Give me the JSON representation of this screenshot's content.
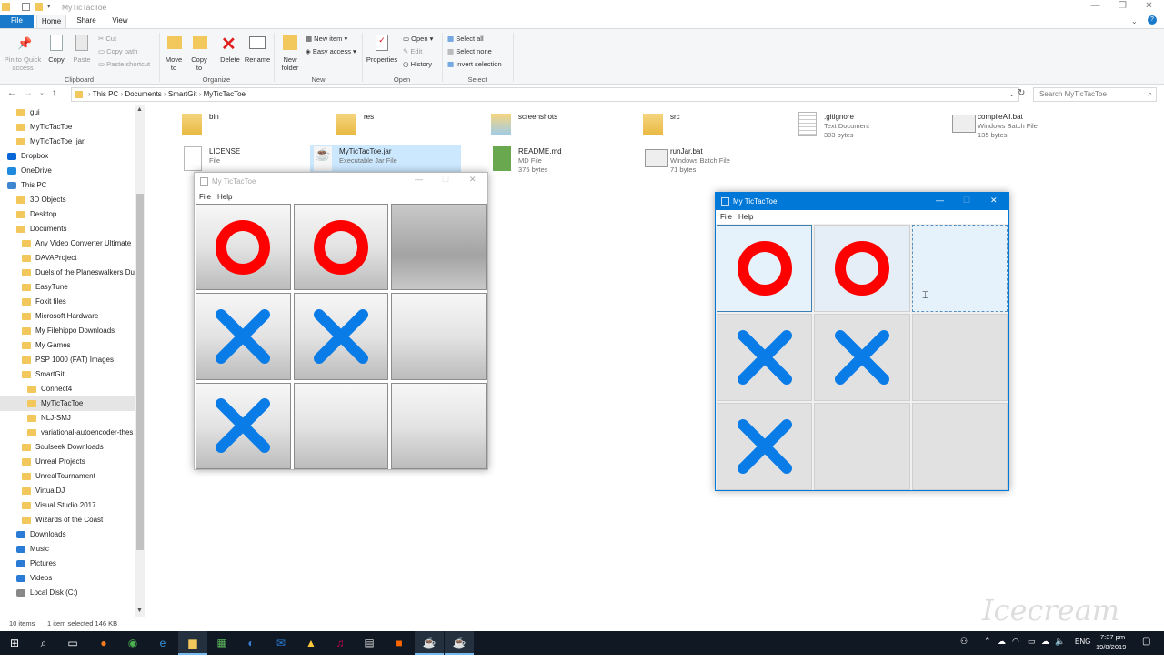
{
  "window": {
    "title": "MyTicTacToe"
  },
  "ribbon": {
    "tabs": [
      "File",
      "Home",
      "Share",
      "View"
    ],
    "clipboard": {
      "pin": "Pin to Quick\naccess",
      "copy": "Copy",
      "paste": "Paste",
      "cut": "Cut",
      "copy_path": "Copy path",
      "paste_shortcut": "Paste shortcut",
      "label": "Clipboard"
    },
    "organize": {
      "move": "Move\nto",
      "copy": "Copy\nto",
      "delete": "Delete",
      "rename": "Rename",
      "label": "Organize"
    },
    "new": {
      "folder": "New\nfolder",
      "new_item": "New item",
      "easy_access": "Easy access",
      "label": "New"
    },
    "open": {
      "properties": "Properties",
      "open": "Open",
      "edit": "Edit",
      "history": "History",
      "label": "Open"
    },
    "select": {
      "all": "Select all",
      "none": "Select none",
      "invert": "Invert selection",
      "label": "Select"
    }
  },
  "address": {
    "path": [
      "This PC",
      "Documents",
      "SmartGit",
      "MyTicTacToe"
    ],
    "search_placeholder": "Search MyTicTacToe"
  },
  "nav": {
    "items": [
      {
        "label": "gui",
        "indent": 2,
        "icon": "folder"
      },
      {
        "label": "MyTicTacToe",
        "indent": 2,
        "icon": "folder"
      },
      {
        "label": "MyTicTacToe_jar",
        "indent": 2,
        "icon": "folder"
      },
      {
        "label": "Dropbox",
        "indent": 1,
        "icon": "dropbox"
      },
      {
        "label": "OneDrive",
        "indent": 1,
        "icon": "cloud"
      },
      {
        "label": "This PC",
        "indent": 1,
        "icon": "pc"
      },
      {
        "label": "3D Objects",
        "indent": 2,
        "icon": "folder"
      },
      {
        "label": "Desktop",
        "indent": 2,
        "icon": "folder"
      },
      {
        "label": "Documents",
        "indent": 2,
        "icon": "folder"
      },
      {
        "label": "Any Video Converter Ultimate",
        "indent": 3,
        "icon": "folder"
      },
      {
        "label": "DAVAProject",
        "indent": 3,
        "icon": "folder"
      },
      {
        "label": "Duels of the Planeswalkers Dur",
        "indent": 3,
        "icon": "folder"
      },
      {
        "label": "EasyTune",
        "indent": 3,
        "icon": "folder"
      },
      {
        "label": "Foxit files",
        "indent": 3,
        "icon": "folder"
      },
      {
        "label": "Microsoft Hardware",
        "indent": 3,
        "icon": "folder"
      },
      {
        "label": "My Filehippo Downloads",
        "indent": 3,
        "icon": "folder"
      },
      {
        "label": "My Games",
        "indent": 3,
        "icon": "folder"
      },
      {
        "label": "PSP 1000  (FAT) Images",
        "indent": 3,
        "icon": "folder"
      },
      {
        "label": "SmartGit",
        "indent": 3,
        "icon": "folder"
      },
      {
        "label": "Connect4",
        "indent": 4,
        "icon": "folder"
      },
      {
        "label": "MyTicTacToe",
        "indent": 4,
        "icon": "folder",
        "selected": true
      },
      {
        "label": "NLJ-SMJ",
        "indent": 4,
        "icon": "folder"
      },
      {
        "label": "variational-autoencoder-thes",
        "indent": 4,
        "icon": "folder"
      },
      {
        "label": "Soulseek Downloads",
        "indent": 3,
        "icon": "folder"
      },
      {
        "label": "Unreal Projects",
        "indent": 3,
        "icon": "folder"
      },
      {
        "label": "UnrealTournament",
        "indent": 3,
        "icon": "folder"
      },
      {
        "label": "VirtualDJ",
        "indent": 3,
        "icon": "folder"
      },
      {
        "label": "Visual Studio 2017",
        "indent": 3,
        "icon": "folder"
      },
      {
        "label": "Wizards of the Coast",
        "indent": 3,
        "icon": "folder"
      },
      {
        "label": "Downloads",
        "indent": 2,
        "icon": "download"
      },
      {
        "label": "Music",
        "indent": 2,
        "icon": "music"
      },
      {
        "label": "Pictures",
        "indent": 2,
        "icon": "pictures"
      },
      {
        "label": "Videos",
        "indent": 2,
        "icon": "videos"
      },
      {
        "label": "Local Disk (C:)",
        "indent": 2,
        "icon": "disk"
      }
    ]
  },
  "files": [
    {
      "name": "bin",
      "type": "",
      "size": "",
      "icon": "folder"
    },
    {
      "name": "res",
      "type": "",
      "size": "",
      "icon": "folder"
    },
    {
      "name": "screenshots",
      "type": "",
      "size": "",
      "icon": "folder-images"
    },
    {
      "name": "src",
      "type": "",
      "size": "",
      "icon": "folder"
    },
    {
      "name": ".gitignore",
      "type": "Text Document",
      "size": "303 bytes",
      "icon": "text"
    },
    {
      "name": "compileAll.bat",
      "type": "Windows Batch File",
      "size": "135 bytes",
      "icon": "gear"
    },
    {
      "name": "LICENSE",
      "type": "File",
      "size": "",
      "icon": "blank"
    },
    {
      "name": "MyTicTacToe.jar",
      "type": "Executable Jar File",
      "size": "",
      "icon": "java"
    },
    {
      "name": "README.md",
      "type": "MD File",
      "size": "375 bytes",
      "icon": "md"
    },
    {
      "name": "runJar.bat",
      "type": "Windows Batch File",
      "size": "71 bytes",
      "icon": "gear"
    }
  ],
  "status": {
    "count": "10 items",
    "selected": "1 item selected  146 KB"
  },
  "game_inactive": {
    "title": "My TicTacToe",
    "menu": [
      "File",
      "Help"
    ],
    "board": [
      "O",
      "O",
      "",
      "X",
      "X",
      "",
      "X",
      "",
      ""
    ]
  },
  "game_active": {
    "title": "My TicTacToe",
    "menu": [
      "File",
      "Help"
    ],
    "board": [
      "O",
      "O",
      "",
      "X",
      "X",
      "",
      "X",
      "",
      ""
    ]
  },
  "tray": {
    "lang": "ENG",
    "time": "7:37 pm",
    "date": "19/8/2019"
  },
  "watermark": "Icecream APPS",
  "colors": {
    "o": "#ff0000",
    "x": "#0a7ce8",
    "accent": "#0078d7"
  }
}
